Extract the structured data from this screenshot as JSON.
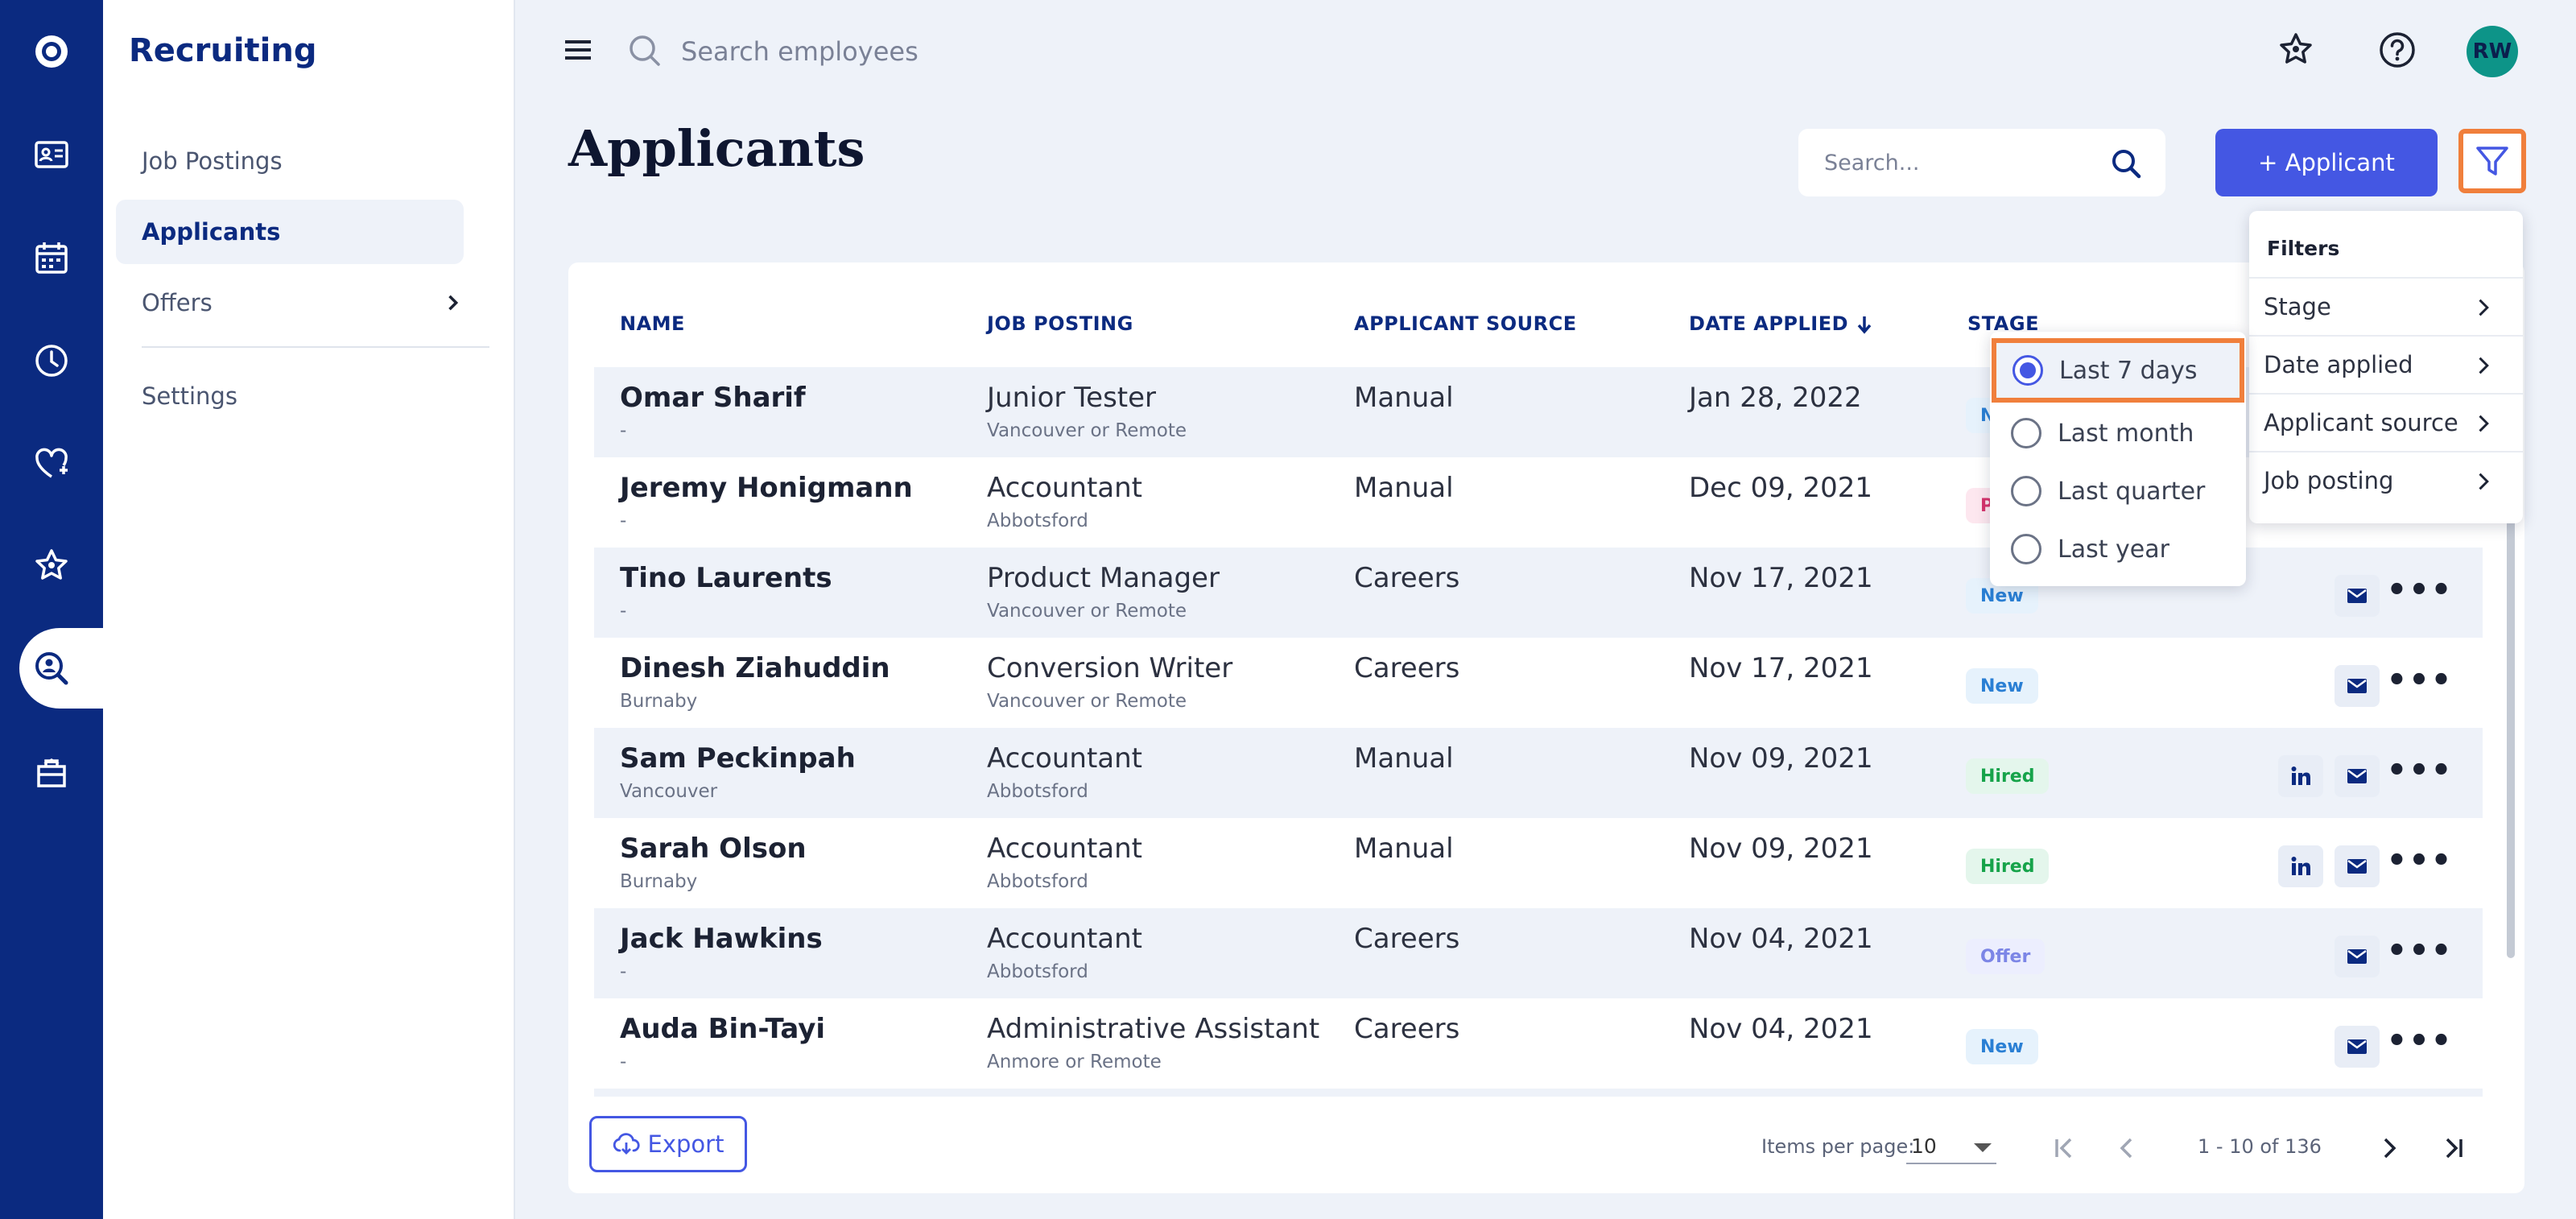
{
  "app": {
    "section_title": "Recruiting",
    "accent": "#0b2a80",
    "primary": "#4457e3",
    "highlight": "#f07f3c"
  },
  "rail": {
    "icons": [
      "app-logo-icon",
      "id-card-icon",
      "calendar-icon",
      "clock-icon",
      "heart-icon",
      "star-icon",
      "recruiting-search-icon",
      "toolbox-icon"
    ]
  },
  "subnav": {
    "items": [
      {
        "label": "Job Postings"
      },
      {
        "label": "Applicants"
      },
      {
        "label": "Offers"
      },
      {
        "label": "Settings"
      }
    ]
  },
  "topbar": {
    "search_placeholder": "Search employees",
    "avatar_initials": "RW"
  },
  "page": {
    "title": "Applicants",
    "search_placeholder": "Search...",
    "add_button": "+ Applicant"
  },
  "table": {
    "columns": {
      "name": "NAME",
      "job_posting": "JOB POSTING",
      "source": "APPLICANT SOURCE",
      "date": "DATE APPLIED",
      "stage": "STAGE"
    },
    "rows": [
      {
        "name": "Omar Sharif",
        "location": "-",
        "job": "Junior Tester",
        "job_location": "Vancouver or Remote",
        "source": "Manual",
        "date": "Jan 28, 2022",
        "stage": "N",
        "stage_type": "new",
        "linkedin": false
      },
      {
        "name": "Jeremy Honigmann",
        "location": "-",
        "job": "Accountant",
        "job_location": "Abbotsford",
        "source": "Manual",
        "date": "Dec 09, 2021",
        "stage": "P",
        "stage_type": "pending",
        "linkedin": false
      },
      {
        "name": "Tino Laurents",
        "location": "-",
        "job": "Product Manager",
        "job_location": "Vancouver or Remote",
        "source": "Careers",
        "date": "Nov 17, 2021",
        "stage": "New",
        "stage_type": "new",
        "linkedin": false
      },
      {
        "name": "Dinesh Ziahuddin",
        "location": "Burnaby",
        "job": "Conversion Writer",
        "job_location": "Vancouver or Remote",
        "source": "Careers",
        "date": "Nov 17, 2021",
        "stage": "New",
        "stage_type": "new",
        "linkedin": false
      },
      {
        "name": "Sam Peckinpah",
        "location": "Vancouver",
        "job": "Accountant",
        "job_location": "Abbotsford",
        "source": "Manual",
        "date": "Nov 09, 2021",
        "stage": "Hired",
        "stage_type": "hired",
        "linkedin": true
      },
      {
        "name": "Sarah Olson",
        "location": "Burnaby",
        "job": "Accountant",
        "job_location": "Abbotsford",
        "source": "Manual",
        "date": "Nov 09, 2021",
        "stage": "Hired",
        "stage_type": "hired",
        "linkedin": true
      },
      {
        "name": "Jack Hawkins",
        "location": "-",
        "job": "Accountant",
        "job_location": "Abbotsford",
        "source": "Careers",
        "date": "Nov 04, 2021",
        "stage": "Offer",
        "stage_type": "offer",
        "linkedin": false
      },
      {
        "name": "Auda Bin-Tayi",
        "location": "-",
        "job": "Administrative Assistant",
        "job_location": "Anmore or Remote",
        "source": "Careers",
        "date": "Nov 04, 2021",
        "stage": "New",
        "stage_type": "new",
        "linkedin": false
      }
    ]
  },
  "footer": {
    "export_label": "Export",
    "items_per_page_label": "Items per page:",
    "items_per_page_value": "10",
    "range_label": "1 - 10 of 136"
  },
  "filters_menu": {
    "title": "Filters",
    "items": [
      {
        "label": "Stage"
      },
      {
        "label": "Date applied"
      },
      {
        "label": "Applicant source"
      },
      {
        "label": "Job posting"
      }
    ]
  },
  "date_menu": {
    "options": [
      {
        "label": "Last 7 days",
        "selected": true
      },
      {
        "label": "Last month",
        "selected": false
      },
      {
        "label": "Last quarter",
        "selected": false
      },
      {
        "label": "Last year",
        "selected": false
      }
    ]
  }
}
